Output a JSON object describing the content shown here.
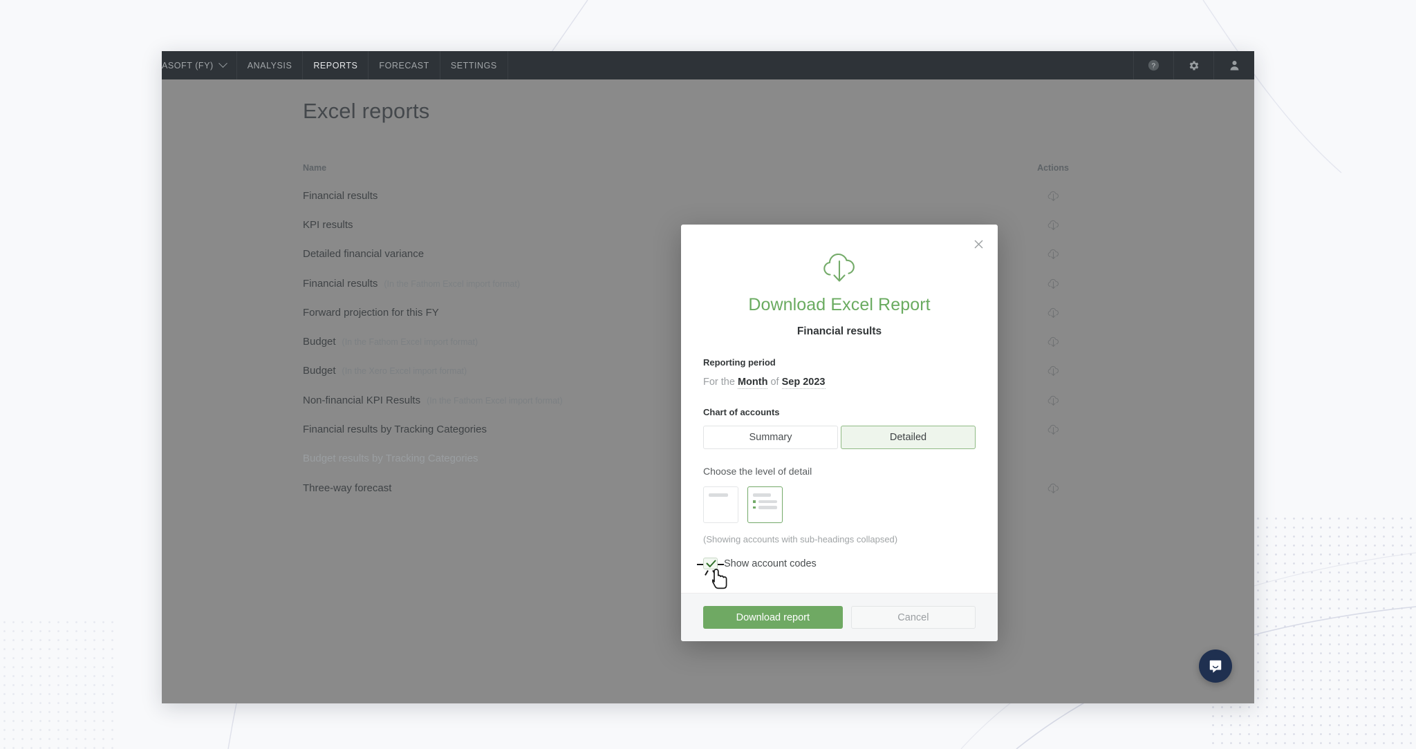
{
  "nav": {
    "company": "ASOFT (FY)",
    "items": [
      {
        "label": "ANALYSIS",
        "active": false
      },
      {
        "label": "REPORTS",
        "active": true
      },
      {
        "label": "FORECAST",
        "active": false
      },
      {
        "label": "SETTINGS",
        "active": false
      }
    ],
    "icons": {
      "help": "help-icon",
      "settings": "gear-icon",
      "account": "user-icon"
    }
  },
  "page": {
    "title": "Excel reports"
  },
  "table": {
    "columns": {
      "name": "Name",
      "actions": "Actions"
    },
    "rows": [
      {
        "name": "Financial results",
        "note": "",
        "disabled": false,
        "has_action": true
      },
      {
        "name": "KPI results",
        "note": "",
        "disabled": false,
        "has_action": true
      },
      {
        "name": "Detailed financial variance",
        "note": "",
        "disabled": false,
        "has_action": true
      },
      {
        "name": "Financial results",
        "note": "(In the Fathom Excel import format)",
        "disabled": false,
        "has_action": true
      },
      {
        "name": "Forward projection for this FY",
        "note": "",
        "disabled": false,
        "has_action": true
      },
      {
        "name": "Budget",
        "note": "(In the Fathom Excel import format)",
        "disabled": false,
        "has_action": true
      },
      {
        "name": "Budget",
        "note": "(In the Xero Excel import format)",
        "disabled": false,
        "has_action": true
      },
      {
        "name": "Non-financial KPI Results",
        "note": "(In the Fathom Excel import format)",
        "disabled": false,
        "has_action": true
      },
      {
        "name": "Financial results by Tracking Categories",
        "note": "",
        "disabled": false,
        "has_action": true
      },
      {
        "name": "Budget results by Tracking Categories",
        "note": "",
        "disabled": true,
        "has_action": false
      },
      {
        "name": "Three-way forecast",
        "note": "",
        "disabled": false,
        "has_action": true
      }
    ]
  },
  "modal": {
    "close_label": "×",
    "icon": "cloud-download-icon",
    "title": "Download Excel Report",
    "subtitle": "Financial results",
    "reporting_period": {
      "label": "Reporting period",
      "prefix": "For the",
      "period_type": "Month",
      "connector": "of",
      "period_value": "Sep 2023"
    },
    "chart_of_accounts": {
      "label": "Chart of accounts",
      "options": [
        {
          "label": "Summary",
          "selected": false
        },
        {
          "label": "Detailed",
          "selected": true
        }
      ]
    },
    "level_of_detail": {
      "label": "Choose the level of detail",
      "tiles": [
        {
          "name": "flat-list-tile",
          "selected": false
        },
        {
          "name": "sub-headings-tile",
          "selected": true
        }
      ],
      "hint": "(Showing accounts with sub-headings collapsed)"
    },
    "show_account_codes": {
      "label": "Show account codes",
      "checked": true
    },
    "footer": {
      "primary": "Download report",
      "secondary": "Cancel"
    }
  },
  "widgets": {
    "intercom": "chat-bubble-icon"
  },
  "colors": {
    "accent_green": "#6fa963",
    "title_green": "#6aab60",
    "nav_dark": "#2e3338",
    "overlay_gray": "#8a8a8a",
    "intercom_navy": "#1f3050",
    "page_bg": "#f8f9fb"
  }
}
